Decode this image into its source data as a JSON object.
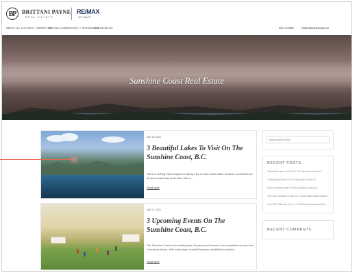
{
  "header": {
    "logo_mark": "BP",
    "brand_name": "BRITTANI PAYNE",
    "brand_sub": "REAL ESTATE",
    "partner_logo": "RE/MAX",
    "partner_sub": "CITY REALTY"
  },
  "nav": {
    "items": [
      "ABOUT US",
      "LISTINGS + MARKETING",
      "BUYING",
      "COMMUNITIES + RESOURCES",
      "CONTACT",
      "BLOG"
    ],
    "phone": "604.741.8809",
    "email": "brittani@brittanipayne.ca"
  },
  "hero": {
    "title": "Sunshine Coast Real Estate"
  },
  "posts": [
    {
      "date": "MAY 26, 2021",
      "title": "3 Beautiful Lakes To Visit On The Sunshine Coast, B.C.",
      "excerpt": "There is nothing that compares to taking a dip in fresh ocean water, however, sometimes we all need a quiet day at the lake. Take a...",
      "read_more": "Read More"
    },
    {
      "date": "MAY 17, 2021",
      "title": "3 Upcoming Events On The Sunshine Coast, B.C.",
      "excerpt": "The Sunshine Coast is a beautiful place all year round however, the summertime is when the Coast truly shines. With warm days, beautiful beaches, established festivals...",
      "read_more": "Read More"
    }
  ],
  "sidebar": {
    "search_placeholder": "Search and hit Enter",
    "recent_posts_title": "RECENT POSTS",
    "recent_posts": [
      "3 Beautiful Lakes To Visit On The Sunshine Coast, B.C.",
      "3 Upcoming Events On The Sunshine Coast, B.C.",
      "Find Your New Home On The Sunshine Coast, B.C.",
      "Your 2021 Sunshine Coast, B.C. Real Estate Market Update",
      "Your 2021 February Top B.C. Real Estate News Headlines"
    ],
    "recent_comments_title": "RECENT COMMENTS"
  },
  "annotation": {
    "color": "#e36a55"
  },
  "colors": {
    "accent": "#e36a55",
    "remax_blue": "#1a2b5a",
    "text_dark": "#333333"
  }
}
